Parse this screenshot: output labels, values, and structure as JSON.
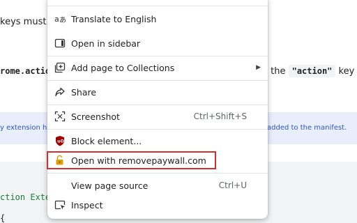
{
  "background": {
    "line1": "keys must be",
    "line2_code": "rome.action",
    "line2_right_text": "e the",
    "line2_right_code": "\"action\"",
    "line2_right_tail": "key in",
    "note_left": "y extension he",
    "note_right": "added to the manifest.",
    "code_line1": "ction Exter",
    "code_line2": "{"
  },
  "menu": {
    "items": [
      {
        "label": "Translate to English",
        "icon": "translate-icon"
      },
      {
        "label": "Open in sidebar",
        "icon": "sidebar-icon"
      },
      {
        "label": "Add page to Collections",
        "icon": "collections-icon"
      },
      {
        "label": "Share",
        "icon": "share-icon"
      },
      {
        "label": "Screenshot",
        "icon": "screenshot-icon",
        "shortcut": "Ctrl+Shift+S"
      },
      {
        "label": "Block element...",
        "icon": "ublock-icon"
      },
      {
        "label": "Open with removepaywall.com",
        "icon": "unlock-icon"
      },
      {
        "label": "View page source",
        "shortcut": "Ctrl+U"
      },
      {
        "label": "Inspect",
        "icon": "inspect-icon"
      }
    ],
    "submenu_arrow": "▶"
  },
  "colors": {
    "highlight_border": "#d32f2f",
    "note_text": "#2f55c3",
    "ublock_red": "#a00000",
    "lock_gold": "#e0a000"
  }
}
